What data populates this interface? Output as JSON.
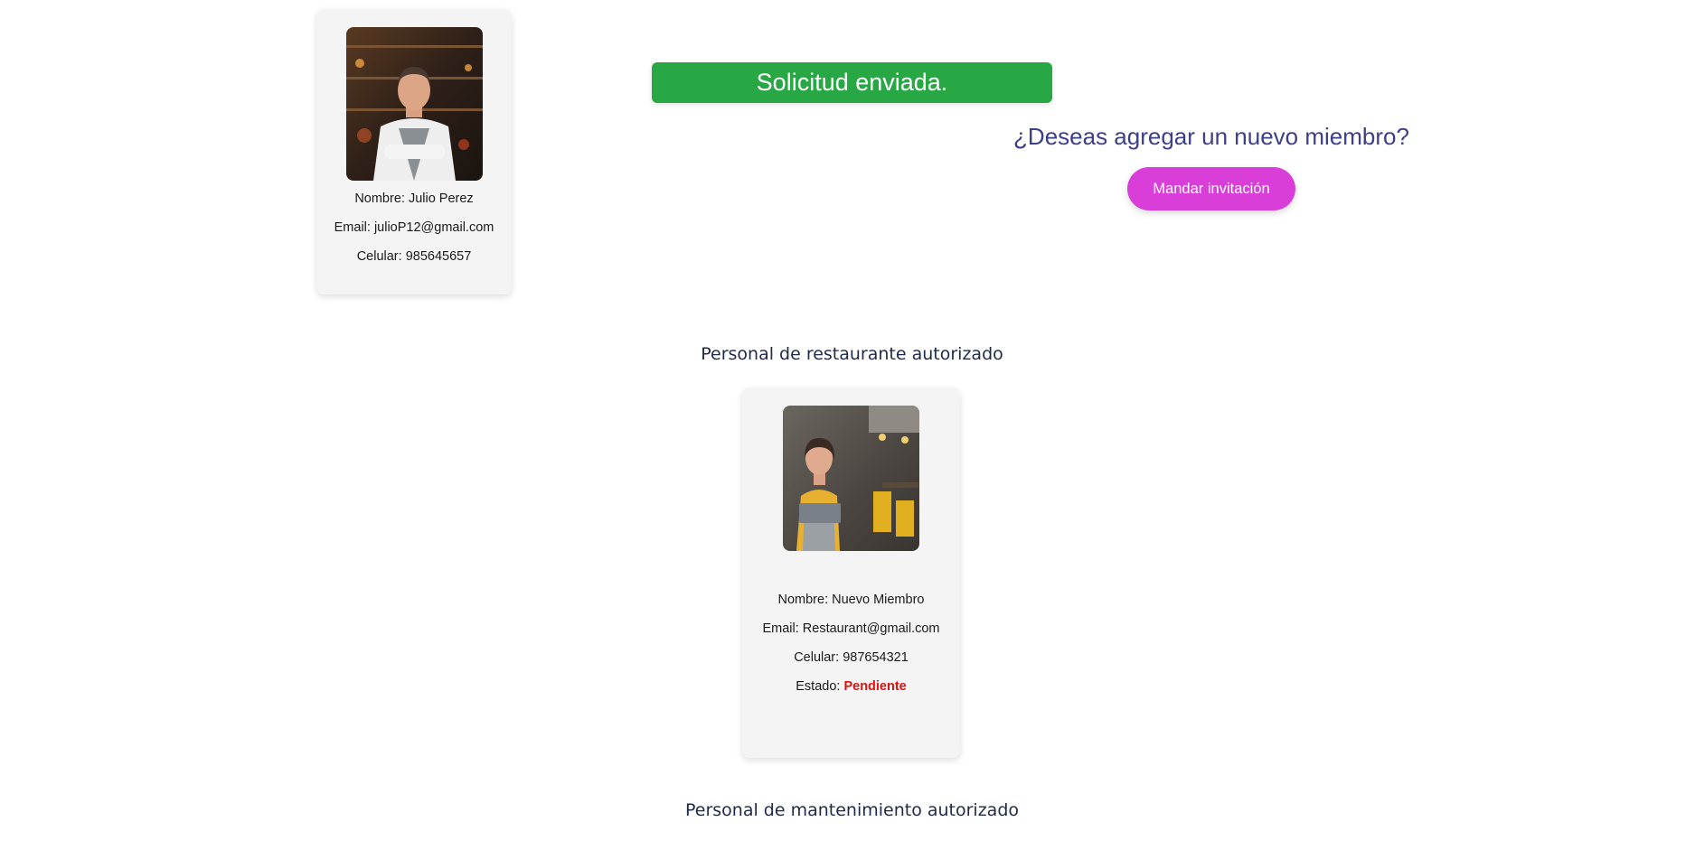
{
  "banner": {
    "text": "Solicitud enviada."
  },
  "invite": {
    "question": "¿Deseas agregar un nuevo miembro?",
    "button_label": "Mandar invitación",
    "button_color": "#d93ed9"
  },
  "owner": {
    "name_line": "Nombre: Julio Perez",
    "email_line": "Email: julioP12@gmail.com",
    "phone_line": "Celular: 985645657"
  },
  "sections": {
    "restaurant_title": "Personal de restaurante autorizado",
    "maintenance_title": "Personal de mantenimiento autorizado"
  },
  "members": [
    {
      "name_line": "Nombre: Nuevo Miembro",
      "email_line": "Email: Restaurant@gmail.com",
      "phone_line": "Celular: 987654321",
      "status_label": "Estado:",
      "status_value": "Pendiente",
      "status_color": "#dd1111"
    }
  ],
  "colors": {
    "success": "#28a745",
    "heading": "#3d3f88"
  }
}
